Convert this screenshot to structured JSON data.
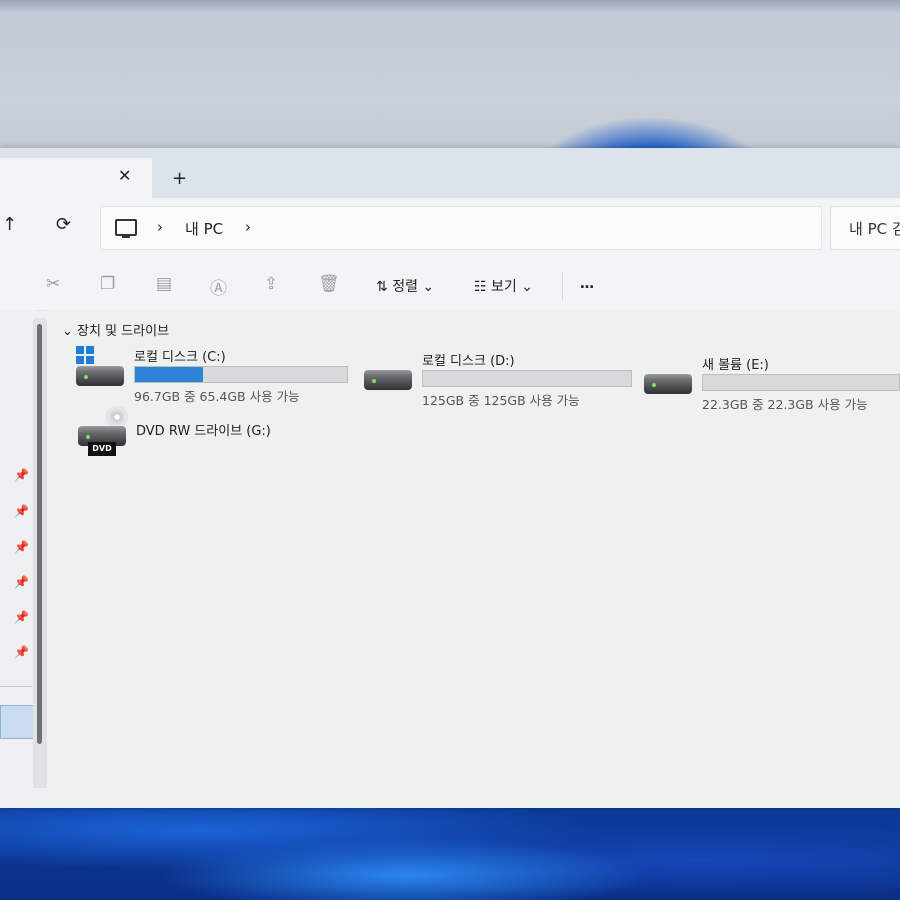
{
  "tab": {
    "close_glyph": "✕",
    "add_glyph": "+"
  },
  "nav": {
    "up_glyph": "↑",
    "refresh_glyph": "⟳",
    "crumb_sep1": "›",
    "location": "내 PC",
    "crumb_sep2": "›"
  },
  "search": {
    "text": "내 PC 검"
  },
  "toolbar": {
    "cut_icon": "scissors-icon",
    "copy_icon": "copy-icon",
    "paste_icon": "paste-icon",
    "rename_icon": "rename-icon",
    "share_icon": "share-icon",
    "delete_icon": "trash-icon",
    "sort_label": "정렬",
    "view_label": "보기",
    "more_label": "…"
  },
  "group": {
    "toggle_glyph": "⌄",
    "title": "장치 및 드라이브"
  },
  "drives": [
    {
      "name": "로컬 디스크 (C:)",
      "size_text": "96.7GB 중 65.4GB 사용 가능",
      "used_fraction": 0.32,
      "icon": "windows-drive-icon"
    },
    {
      "name": "로컬 디스크 (D:)",
      "size_text": "125GB 중 125GB 사용 가능",
      "used_fraction": 0.0,
      "icon": "hard-drive-icon"
    },
    {
      "name": "새 볼륨 (E:)",
      "size_text": "22.3GB 중 22.3GB 사용 가능",
      "used_fraction": 0.0,
      "icon": "hard-drive-icon"
    },
    {
      "name": "DVD RW 드라이브 (G:)",
      "badge": "DVD",
      "icon": "dvd-drive-icon"
    }
  ],
  "colors": {
    "progress_fill": "#2d84d4",
    "selection": "#c9dbee"
  }
}
